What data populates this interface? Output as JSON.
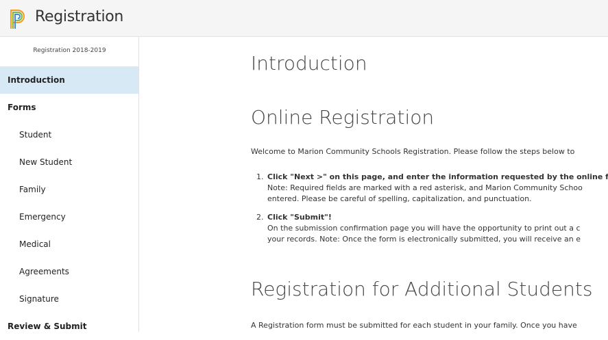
{
  "header": {
    "title": "Registration",
    "logo_icon": "powerschool-logo-icon",
    "colors": {
      "background": "#f5f5f5",
      "logo_orange": "#f29b1d",
      "logo_green": "#7ab648",
      "logo_blue": "#3e8ed0"
    }
  },
  "sidebar": {
    "term": "Registration 2018-2019",
    "items": [
      {
        "label": "Introduction",
        "level": "top",
        "active": true
      },
      {
        "label": "Forms",
        "level": "top",
        "active": false
      },
      {
        "label": "Student",
        "level": "sub",
        "active": false
      },
      {
        "label": "New Student",
        "level": "sub",
        "active": false
      },
      {
        "label": "Family",
        "level": "sub",
        "active": false
      },
      {
        "label": "Emergency",
        "level": "sub",
        "active": false
      },
      {
        "label": "Medical",
        "level": "sub",
        "active": false
      },
      {
        "label": "Agreements",
        "level": "sub",
        "active": false
      },
      {
        "label": "Signature",
        "level": "sub",
        "active": false
      },
      {
        "label": "Review & Submit",
        "level": "top",
        "active": false
      }
    ],
    "active_color": "#d6e9f5"
  },
  "main": {
    "page_title": "Introduction",
    "section1": {
      "heading": "Online Registration",
      "welcome": "Welcome to Marion Community Schools Registration.  Please follow the steps below to",
      "steps": [
        {
          "number": "1.",
          "title": "Click \"Next >\" on this page, and enter the information requested by the online fo",
          "line2": "Note: Required fields are marked with a red asterisk, and Marion Community Schoo",
          "line3": "entered.  Please be careful of spelling, capitalization, and punctuation."
        },
        {
          "number": "2.",
          "title": "Click \"Submit\"!",
          "line2": "On the submission confirmation page you will have the opportunity to print out a c",
          "line3": "your records.  Note:  Once the form is electronically submitted, you will receive an e"
        }
      ]
    },
    "section2": {
      "heading": "Registration for Additional Students",
      "text": "A Registration form must be submitted for each student in your family. Once you have"
    }
  }
}
